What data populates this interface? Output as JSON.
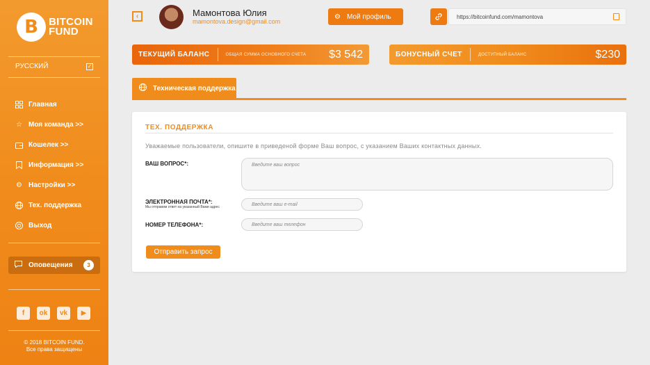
{
  "brand": {
    "logo_letter": "B",
    "line1": "BITCOIN",
    "line2": "FUND"
  },
  "language": {
    "label": "РУССКИЙ",
    "check": "✓"
  },
  "nav": [
    {
      "label": "Главная",
      "icon": "grid-icon"
    },
    {
      "label": "Моя команда >>",
      "icon": "star-icon"
    },
    {
      "label": "Кошелек >>",
      "icon": "wallet-icon"
    },
    {
      "label": "Информация >>",
      "icon": "bookmark-icon"
    },
    {
      "label": "Настройки >>",
      "icon": "gear-icon"
    },
    {
      "label": "Тех. поддержка",
      "icon": "globe-icon"
    },
    {
      "label": "Выход",
      "icon": "power-icon"
    }
  ],
  "notifications": {
    "label": "Оповещения",
    "count": "3"
  },
  "socials": [
    "f",
    "ok",
    "vk",
    "yt"
  ],
  "footer": {
    "line1": "© 2018 BITCOIN FUND.",
    "line2": "Все права защищены"
  },
  "user": {
    "name": "Мамонтова Юлия",
    "email": "mamontova.design@gmail.com"
  },
  "header": {
    "profile_label": "Мой профиль",
    "ref_link": "https://bitcoinfund.com/mamontova"
  },
  "balances": {
    "current": {
      "label": "ТЕКУЩИЙ БАЛАНС",
      "sub": "ОБЩАЯ СУММА ОСНОВНОГО СЧЁТА",
      "amount": "$3 542"
    },
    "bonus": {
      "label": "БОНУСНЫЙ СЧЕТ",
      "sub": "ДОСТУПНЫЙ БАЛАНС",
      "amount": "$230"
    }
  },
  "tab": {
    "label": "Техническая поддержка"
  },
  "form": {
    "title": "ТЕХ. ПОДДЕРЖКА",
    "intro": "Уважаемые пользователи, опишите в приведеной форме Ваш вопрос, с указанием Ваших контактных данных.",
    "question_label": "ВАШ ВОПРОС*:",
    "question_placeholder": "Введите ваш вопрос",
    "email_label": "ЭЛЕКТРОННАЯ ПОЧТА*:",
    "email_hint": "Мы отправим ответ на указанный Вами адрес",
    "email_placeholder": "Введите ваш e-mail",
    "phone_label": "НОМЕР ТЕЛЕФОНА*:",
    "phone_placeholder": "Введите ваш телефон",
    "submit_label": "Отправить запрос"
  },
  "colors": {
    "accent": "#f08c1c",
    "accent_dark": "#c96d10",
    "background": "#ececec"
  }
}
